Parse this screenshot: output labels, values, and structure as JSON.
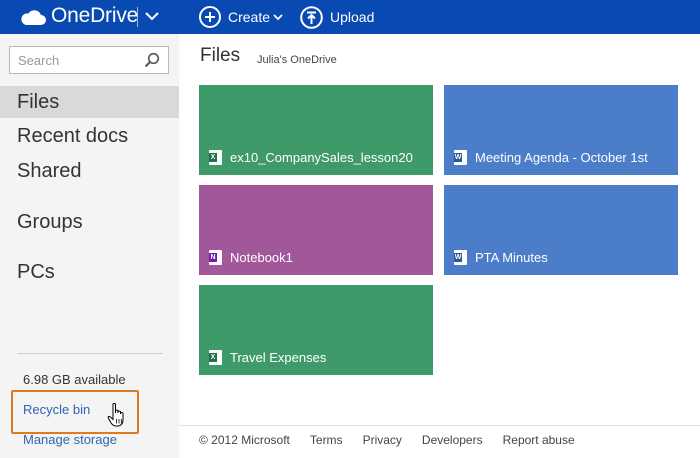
{
  "header": {
    "app_name": "OneDrive",
    "create_label": "Create",
    "upload_label": "Upload"
  },
  "sidebar": {
    "search_placeholder": "Search",
    "items": [
      {
        "label": "Files",
        "active": true
      },
      {
        "label": "Recent docs",
        "active": false
      },
      {
        "label": "Shared",
        "active": false
      },
      {
        "label": "Groups",
        "active": false
      },
      {
        "label": "PCs",
        "active": false
      }
    ],
    "storage_available": "6.98 GB available",
    "recycle_bin": "Recycle bin",
    "manage_storage": "Manage storage"
  },
  "main": {
    "title": "Files",
    "subtitle": "Julia's OneDrive",
    "tiles": [
      {
        "name": "ex10_CompanySales_lesson20",
        "type": "excel",
        "color": "#3f9a6a"
      },
      {
        "name": "Meeting Agenda - October 1st",
        "type": "word",
        "color": "#4b7dc9"
      },
      {
        "name": "Notebook1",
        "type": "onenote",
        "color": "#a3579b"
      },
      {
        "name": "PTA Minutes",
        "type": "word",
        "color": "#4b7dc9"
      },
      {
        "name": "Travel Expenses",
        "type": "excel",
        "color": "#3f9a6a"
      }
    ]
  },
  "footer": {
    "copyright": "© 2012 Microsoft",
    "links": [
      "Terms",
      "Privacy",
      "Developers",
      "Report abuse"
    ]
  },
  "colors": {
    "header_bg": "#094ab2",
    "sidebar_bg": "#f4f4f4",
    "link": "#2e64b4",
    "highlight": "#e07a1f"
  }
}
